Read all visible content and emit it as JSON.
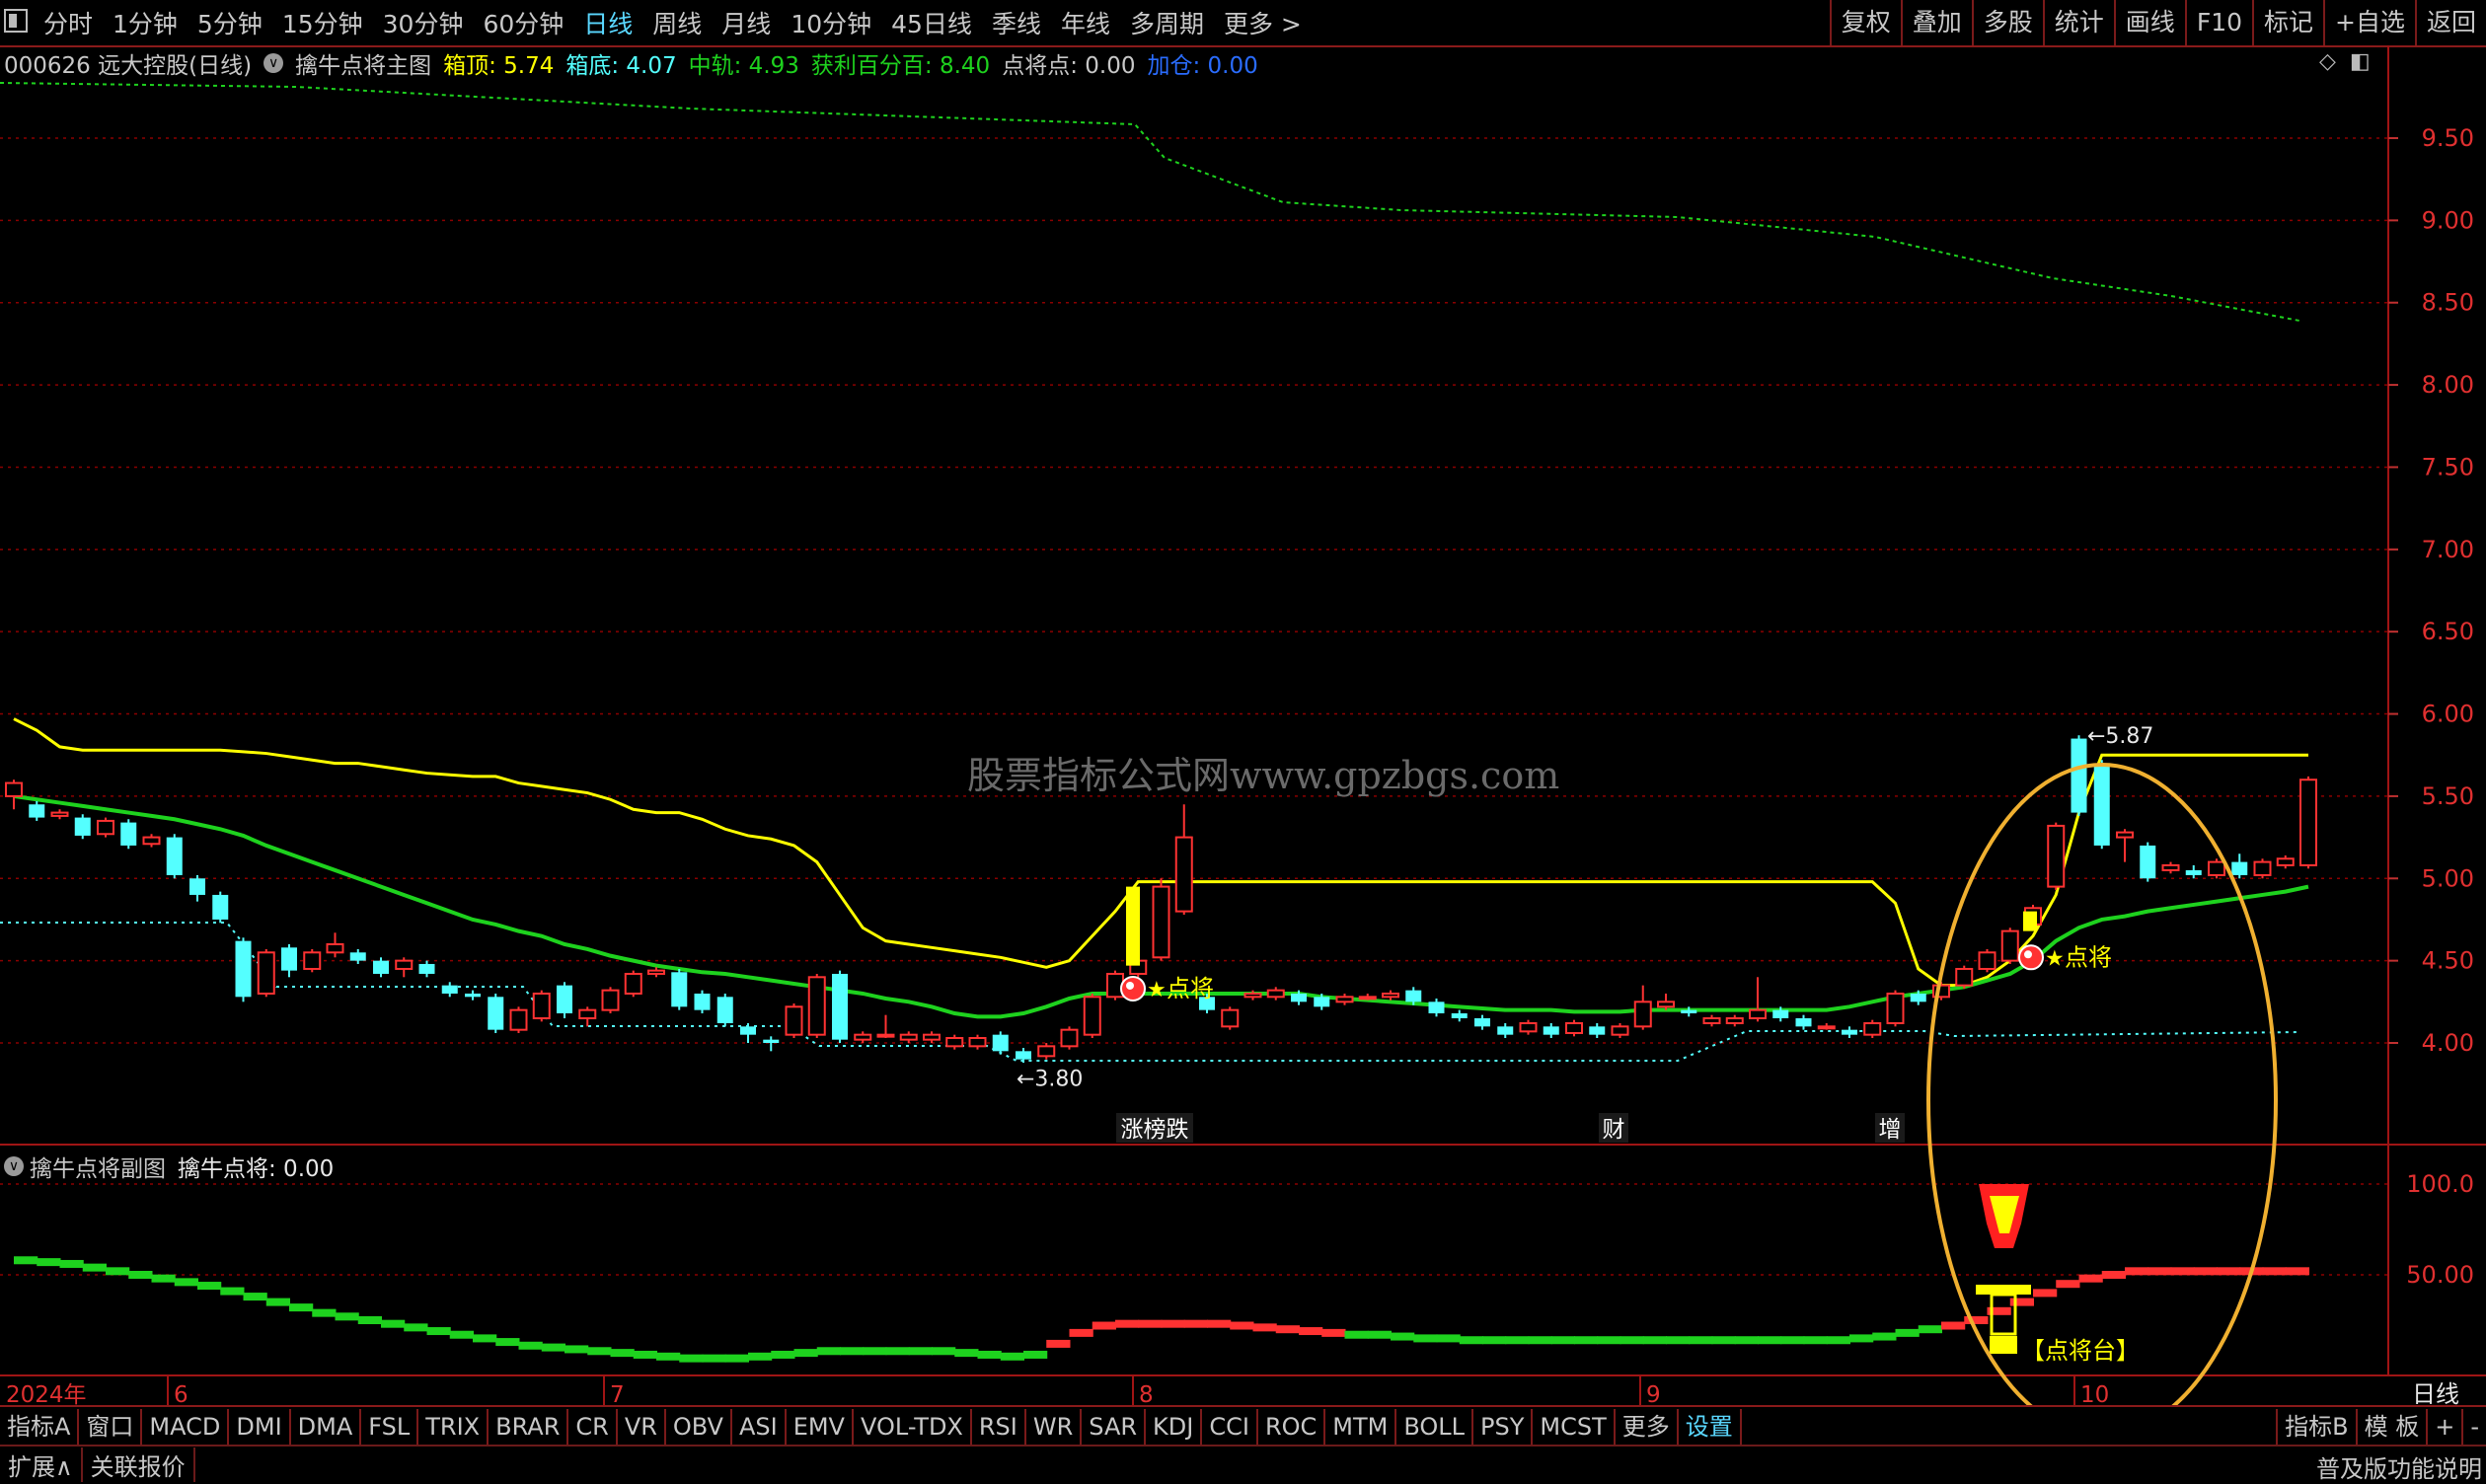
{
  "toolbar": {
    "periods": [
      "分时",
      "1分钟",
      "5分钟",
      "15分钟",
      "30分钟",
      "60分钟",
      "日线",
      "周线",
      "月线",
      "10分钟",
      "45日线",
      "季线",
      "年线",
      "多周期",
      "更多 >"
    ],
    "active_period": "日线",
    "tools": [
      "复权",
      "叠加",
      "多股",
      "统计",
      "画线",
      "F10",
      "标记",
      "+自选",
      "返回"
    ]
  },
  "main_info": {
    "stock": "000626 远大控股(日线)",
    "indicator_name": "擒牛点将主图",
    "box_top": "箱顶: 5.74",
    "box_bottom": "箱底: 4.07",
    "mid_rail": "中轨: 4.93",
    "profit_pct": "获利百分百: 8.40",
    "dianjiang": "点将点: 0.00",
    "jiacang": "加仓: 0.00"
  },
  "colors": {
    "up": "#ff3232",
    "down": "#54ffff",
    "yellow": "#ffff00",
    "green": "#1ed21e",
    "grid": "#8b0000",
    "orange": "#f0b030"
  },
  "y_axis_main": [
    "9.50",
    "9.00",
    "8.50",
    "8.00",
    "7.50",
    "7.00",
    "6.50",
    "6.00",
    "5.50",
    "5.00",
    "4.50",
    "4.00"
  ],
  "y_axis_sub": [
    "100.0",
    "50.00"
  ],
  "annotations": {
    "high_label": "5.87",
    "low_label": "3.80",
    "dianjiang_label": "点将",
    "dianjiang_label2": "点将",
    "dianjiangtai_label": "点将台",
    "events": [
      {
        "label": "涨榜跌"
      },
      {
        "label": "财"
      },
      {
        "label": "增"
      }
    ]
  },
  "x_axis": {
    "year_label": "2024年",
    "months": [
      "6",
      "7",
      "8",
      "9",
      "10"
    ],
    "period_label": "日线"
  },
  "sub_info": {
    "name": "擒牛点将副图",
    "value": "擒牛点将: 0.00"
  },
  "watermark": "股票指标公式网www.gpzbgs.com",
  "bottom_tabs": [
    "指标A",
    "窗口",
    "MACD",
    "DMI",
    "DMA",
    "FSL",
    "TRIX",
    "BRAR",
    "CR",
    "VR",
    "OBV",
    "ASI",
    "EMV",
    "VOL-TDX",
    "RSI",
    "WR",
    "SAR",
    "KDJ",
    "CCI",
    "ROC",
    "MTM",
    "BOLL",
    "PSY",
    "MCST",
    "更多",
    "设置"
  ],
  "highlighted_tab": "设置",
  "bottom_right": [
    "指标B",
    "模 板",
    "+",
    "-"
  ],
  "statusbar": {
    "items": [
      "扩展∧",
      "关联报价"
    ],
    "right": "普及版功能说明"
  },
  "candles": [
    [
      5.5,
      5.58,
      5.42,
      5.6
    ],
    [
      5.45,
      5.37,
      5.35,
      5.47
    ],
    [
      5.38,
      5.4,
      5.36,
      5.42
    ],
    [
      5.37,
      5.26,
      5.24,
      5.39
    ],
    [
      5.27,
      5.35,
      5.25,
      5.37
    ],
    [
      5.34,
      5.2,
      5.18,
      5.36
    ],
    [
      5.21,
      5.25,
      5.19,
      5.27
    ],
    [
      5.25,
      5.02,
      5.0,
      5.27
    ],
    [
      5.0,
      4.9,
      4.86,
      5.02
    ],
    [
      4.9,
      4.75,
      4.73,
      4.92
    ],
    [
      4.62,
      4.28,
      4.25,
      4.64
    ],
    [
      4.3,
      4.55,
      4.28,
      4.57
    ],
    [
      4.58,
      4.44,
      4.4,
      4.6
    ],
    [
      4.45,
      4.55,
      4.43,
      4.57
    ],
    [
      4.55,
      4.6,
      4.52,
      4.67
    ],
    [
      4.55,
      4.5,
      4.48,
      4.57
    ],
    [
      4.5,
      4.42,
      4.4,
      4.52
    ],
    [
      4.45,
      4.5,
      4.4,
      4.52
    ],
    [
      4.48,
      4.42,
      4.4,
      4.5
    ],
    [
      4.35,
      4.3,
      4.28,
      4.37
    ],
    [
      4.3,
      4.28,
      4.26,
      4.32
    ],
    [
      4.28,
      4.08,
      4.06,
      4.3
    ],
    [
      4.08,
      4.2,
      4.06,
      4.22
    ],
    [
      4.15,
      4.3,
      4.13,
      4.32
    ],
    [
      4.35,
      4.18,
      4.15,
      4.37
    ],
    [
      4.15,
      4.2,
      4.1,
      4.22
    ],
    [
      4.2,
      4.32,
      4.18,
      4.34
    ],
    [
      4.3,
      4.42,
      4.28,
      4.44
    ],
    [
      4.42,
      4.44,
      4.4,
      4.46
    ],
    [
      4.43,
      4.22,
      4.2,
      4.45
    ],
    [
      4.3,
      4.2,
      4.18,
      4.32
    ],
    [
      4.28,
      4.12,
      4.1,
      4.3
    ],
    [
      4.1,
      4.05,
      4.0,
      4.12
    ],
    [
      4.02,
      4.0,
      3.95,
      4.04
    ],
    [
      4.05,
      4.22,
      4.03,
      4.24
    ],
    [
      4.05,
      4.4,
      4.03,
      4.42
    ],
    [
      4.42,
      4.02,
      4.0,
      4.44
    ],
    [
      4.02,
      4.05,
      4.0,
      4.07
    ],
    [
      4.05,
      4.05,
      4.03,
      4.17
    ],
    [
      4.02,
      4.05,
      4.0,
      4.07
    ],
    [
      4.02,
      4.05,
      4.0,
      4.07
    ],
    [
      3.98,
      4.03,
      3.96,
      4.05
    ],
    [
      3.98,
      4.03,
      3.96,
      4.05
    ],
    [
      4.05,
      3.95,
      3.93,
      4.07
    ],
    [
      3.95,
      3.9,
      3.88,
      3.97
    ],
    [
      3.92,
      3.98,
      3.9,
      4.0
    ],
    [
      3.98,
      4.08,
      3.96,
      4.1
    ],
    [
      4.05,
      4.28,
      4.03,
      4.3
    ],
    [
      4.28,
      4.42,
      4.26,
      4.44
    ],
    [
      4.42,
      4.5,
      4.4,
      4.52
    ],
    [
      4.52,
      4.95,
      4.5,
      5.0
    ],
    [
      4.8,
      5.25,
      4.78,
      5.45
    ],
    [
      4.28,
      4.2,
      4.18,
      4.3
    ],
    [
      4.1,
      4.2,
      4.08,
      4.22
    ],
    [
      4.28,
      4.3,
      4.26,
      4.32
    ],
    [
      4.28,
      4.32,
      4.26,
      4.34
    ],
    [
      4.3,
      4.25,
      4.23,
      4.32
    ],
    [
      4.28,
      4.22,
      4.2,
      4.3
    ],
    [
      4.25,
      4.28,
      4.23,
      4.3
    ],
    [
      4.28,
      4.28,
      4.26,
      4.3
    ],
    [
      4.28,
      4.3,
      4.26,
      4.32
    ],
    [
      4.32,
      4.25,
      4.23,
      4.34
    ],
    [
      4.25,
      4.18,
      4.16,
      4.27
    ],
    [
      4.18,
      4.15,
      4.13,
      4.2
    ],
    [
      4.15,
      4.1,
      4.08,
      4.17
    ],
    [
      4.1,
      4.05,
      4.03,
      4.12
    ],
    [
      4.07,
      4.12,
      4.05,
      4.14
    ],
    [
      4.1,
      4.05,
      4.03,
      4.12
    ],
    [
      4.06,
      4.12,
      4.04,
      4.14
    ],
    [
      4.1,
      4.05,
      4.03,
      4.12
    ],
    [
      4.05,
      4.1,
      4.03,
      4.12
    ],
    [
      4.1,
      4.25,
      4.08,
      4.35
    ],
    [
      4.22,
      4.25,
      4.2,
      4.3
    ],
    [
      4.2,
      4.18,
      4.16,
      4.22
    ],
    [
      4.12,
      4.15,
      4.1,
      4.17
    ],
    [
      4.12,
      4.15,
      4.1,
      4.17
    ],
    [
      4.15,
      4.2,
      4.13,
      4.4
    ],
    [
      4.2,
      4.15,
      4.13,
      4.22
    ],
    [
      4.15,
      4.1,
      4.08,
      4.17
    ],
    [
      4.1,
      4.1,
      4.08,
      4.12
    ],
    [
      4.08,
      4.05,
      4.03,
      4.1
    ],
    [
      4.05,
      4.12,
      4.03,
      4.14
    ],
    [
      4.12,
      4.3,
      4.1,
      4.32
    ],
    [
      4.3,
      4.25,
      4.23,
      4.32
    ],
    [
      4.28,
      4.35,
      4.26,
      4.37
    ],
    [
      4.35,
      4.45,
      4.33,
      4.47
    ],
    [
      4.45,
      4.55,
      4.43,
      4.57
    ],
    [
      4.5,
      4.68,
      4.48,
      4.7
    ],
    [
      4.72,
      4.82,
      4.7,
      4.84
    ],
    [
      4.95,
      5.32,
      4.93,
      5.34
    ],
    [
      5.85,
      5.4,
      5.38,
      5.87
    ],
    [
      5.7,
      5.2,
      5.18,
      5.72
    ],
    [
      5.25,
      5.28,
      5.1,
      5.3
    ],
    [
      5.2,
      5.0,
      4.98,
      5.22
    ],
    [
      5.05,
      5.08,
      5.03,
      5.1
    ],
    [
      5.05,
      5.02,
      5.0,
      5.08
    ],
    [
      5.02,
      5.1,
      5.0,
      5.12
    ],
    [
      5.1,
      5.02,
      5.0,
      5.15
    ],
    [
      5.02,
      5.1,
      5.0,
      5.12
    ],
    [
      5.08,
      5.12,
      5.06,
      5.14
    ],
    [
      5.08,
      5.6,
      5.06,
      5.62
    ]
  ],
  "box_top_line": [
    5.97,
    5.9,
    5.8,
    5.78,
    5.78,
    5.78,
    5.78,
    5.78,
    5.78,
    5.78,
    5.77,
    5.76,
    5.74,
    5.72,
    5.7,
    5.7,
    5.68,
    5.66,
    5.64,
    5.63,
    5.62,
    5.62,
    5.58,
    5.56,
    5.54,
    5.52,
    5.48,
    5.42,
    5.4,
    5.4,
    5.36,
    5.3,
    5.26,
    5.24,
    5.2,
    5.1,
    4.9,
    4.7,
    4.62,
    4.6,
    4.58,
    4.56,
    4.54,
    4.52,
    4.49,
    4.46,
    4.5,
    4.65,
    4.8,
    4.98,
    4.98,
    4.98,
    4.98,
    4.98,
    4.98,
    4.98,
    4.98,
    4.98,
    4.98,
    4.98,
    4.98,
    4.98,
    4.98,
    4.98,
    4.98,
    4.98,
    4.98,
    4.98,
    4.98,
    4.98,
    4.98,
    4.98,
    4.98,
    4.98,
    4.98,
    4.98,
    4.98,
    4.98,
    4.98,
    4.98,
    4.98,
    4.98,
    4.85,
    4.45,
    4.35,
    4.35,
    4.4,
    4.5,
    4.65,
    4.9,
    5.4,
    5.75,
    5.75,
    5.75,
    5.75,
    5.75,
    5.75,
    5.75,
    5.75,
    5.75,
    5.75
  ],
  "mid_line": [
    5.5,
    5.48,
    5.46,
    5.44,
    5.42,
    5.4,
    5.38,
    5.36,
    5.33,
    5.3,
    5.26,
    5.2,
    5.15,
    5.1,
    5.05,
    5.0,
    4.95,
    4.9,
    4.85,
    4.8,
    4.75,
    4.72,
    4.68,
    4.65,
    4.6,
    4.57,
    4.53,
    4.5,
    4.47,
    4.45,
    4.43,
    4.42,
    4.4,
    4.38,
    4.36,
    4.34,
    4.32,
    4.3,
    4.27,
    4.25,
    4.22,
    4.18,
    4.16,
    4.16,
    4.18,
    4.22,
    4.27,
    4.3,
    4.3,
    4.3,
    4.3,
    4.3,
    4.3,
    4.3,
    4.3,
    4.3,
    4.3,
    4.28,
    4.27,
    4.26,
    4.25,
    4.24,
    4.23,
    4.22,
    4.21,
    4.2,
    4.2,
    4.2,
    4.19,
    4.19,
    4.19,
    4.2,
    4.2,
    4.2,
    4.2,
    4.2,
    4.2,
    4.2,
    4.2,
    4.2,
    4.22,
    4.25,
    4.28,
    4.3,
    4.32,
    4.34,
    4.38,
    4.42,
    4.5,
    4.62,
    4.7,
    4.75,
    4.77,
    4.8,
    4.82,
    4.84,
    4.86,
    4.88,
    4.9,
    4.92,
    4.95
  ],
  "sub_line": [
    58,
    57,
    56,
    54,
    52,
    50,
    48,
    46,
    44,
    41,
    38,
    35,
    32,
    29,
    27,
    25,
    23,
    21,
    19,
    17,
    15,
    13,
    11,
    10,
    9,
    8,
    7,
    6,
    5,
    4,
    4,
    4,
    4,
    5,
    6,
    7,
    8,
    8,
    8,
    8,
    8,
    7,
    6,
    5,
    5,
    6,
    12,
    18,
    22,
    23,
    23,
    23,
    23,
    22,
    21,
    20,
    19,
    18,
    17,
    17,
    16,
    15,
    15,
    14,
    14,
    14,
    14,
    14,
    14,
    14,
    14,
    14,
    14,
    14,
    14,
    14,
    14,
    14,
    14,
    14,
    14,
    15,
    16,
    18,
    20,
    22,
    25,
    30,
    35,
    40,
    45,
    48,
    50,
    52,
    52,
    52,
    52,
    52,
    52,
    52,
    52
  ]
}
